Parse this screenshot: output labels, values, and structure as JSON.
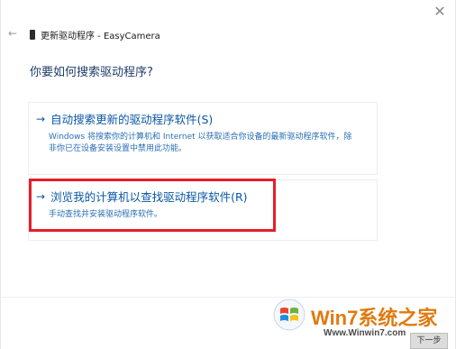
{
  "window": {
    "close_glyph": "✕",
    "back_glyph": "←",
    "title": "更新驱动程序 - EasyCamera"
  },
  "main": {
    "heading": "你要如何搜索驱动程序?",
    "options": [
      {
        "arrow": "→",
        "title": "自动搜索更新的驱动程序软件(S)",
        "description": "Windows 将搜索你的计算机和 Internet 以获取适合你设备的最新驱动程序软件，除\n非你已在设备安装设置中禁用此功能。"
      },
      {
        "arrow": "→",
        "title": "浏览我的计算机以查找驱动程序软件(R)",
        "description": "手动查找并安装驱动程序软件。"
      }
    ]
  },
  "watermark": {
    "text": "Win7系统之家",
    "url": "Www.Winwin7.com",
    "next_label": "下一步"
  },
  "colors": {
    "link_blue": "#0a57a5",
    "highlight_red": "#e51d2a",
    "heading_blue": "#1f3d6b"
  },
  "icons": {
    "close": "close-icon",
    "back": "back-arrow-icon",
    "device": "device-icon",
    "option_arrow": "right-arrow-icon",
    "watermark_logo": "windows-flag-icon"
  }
}
